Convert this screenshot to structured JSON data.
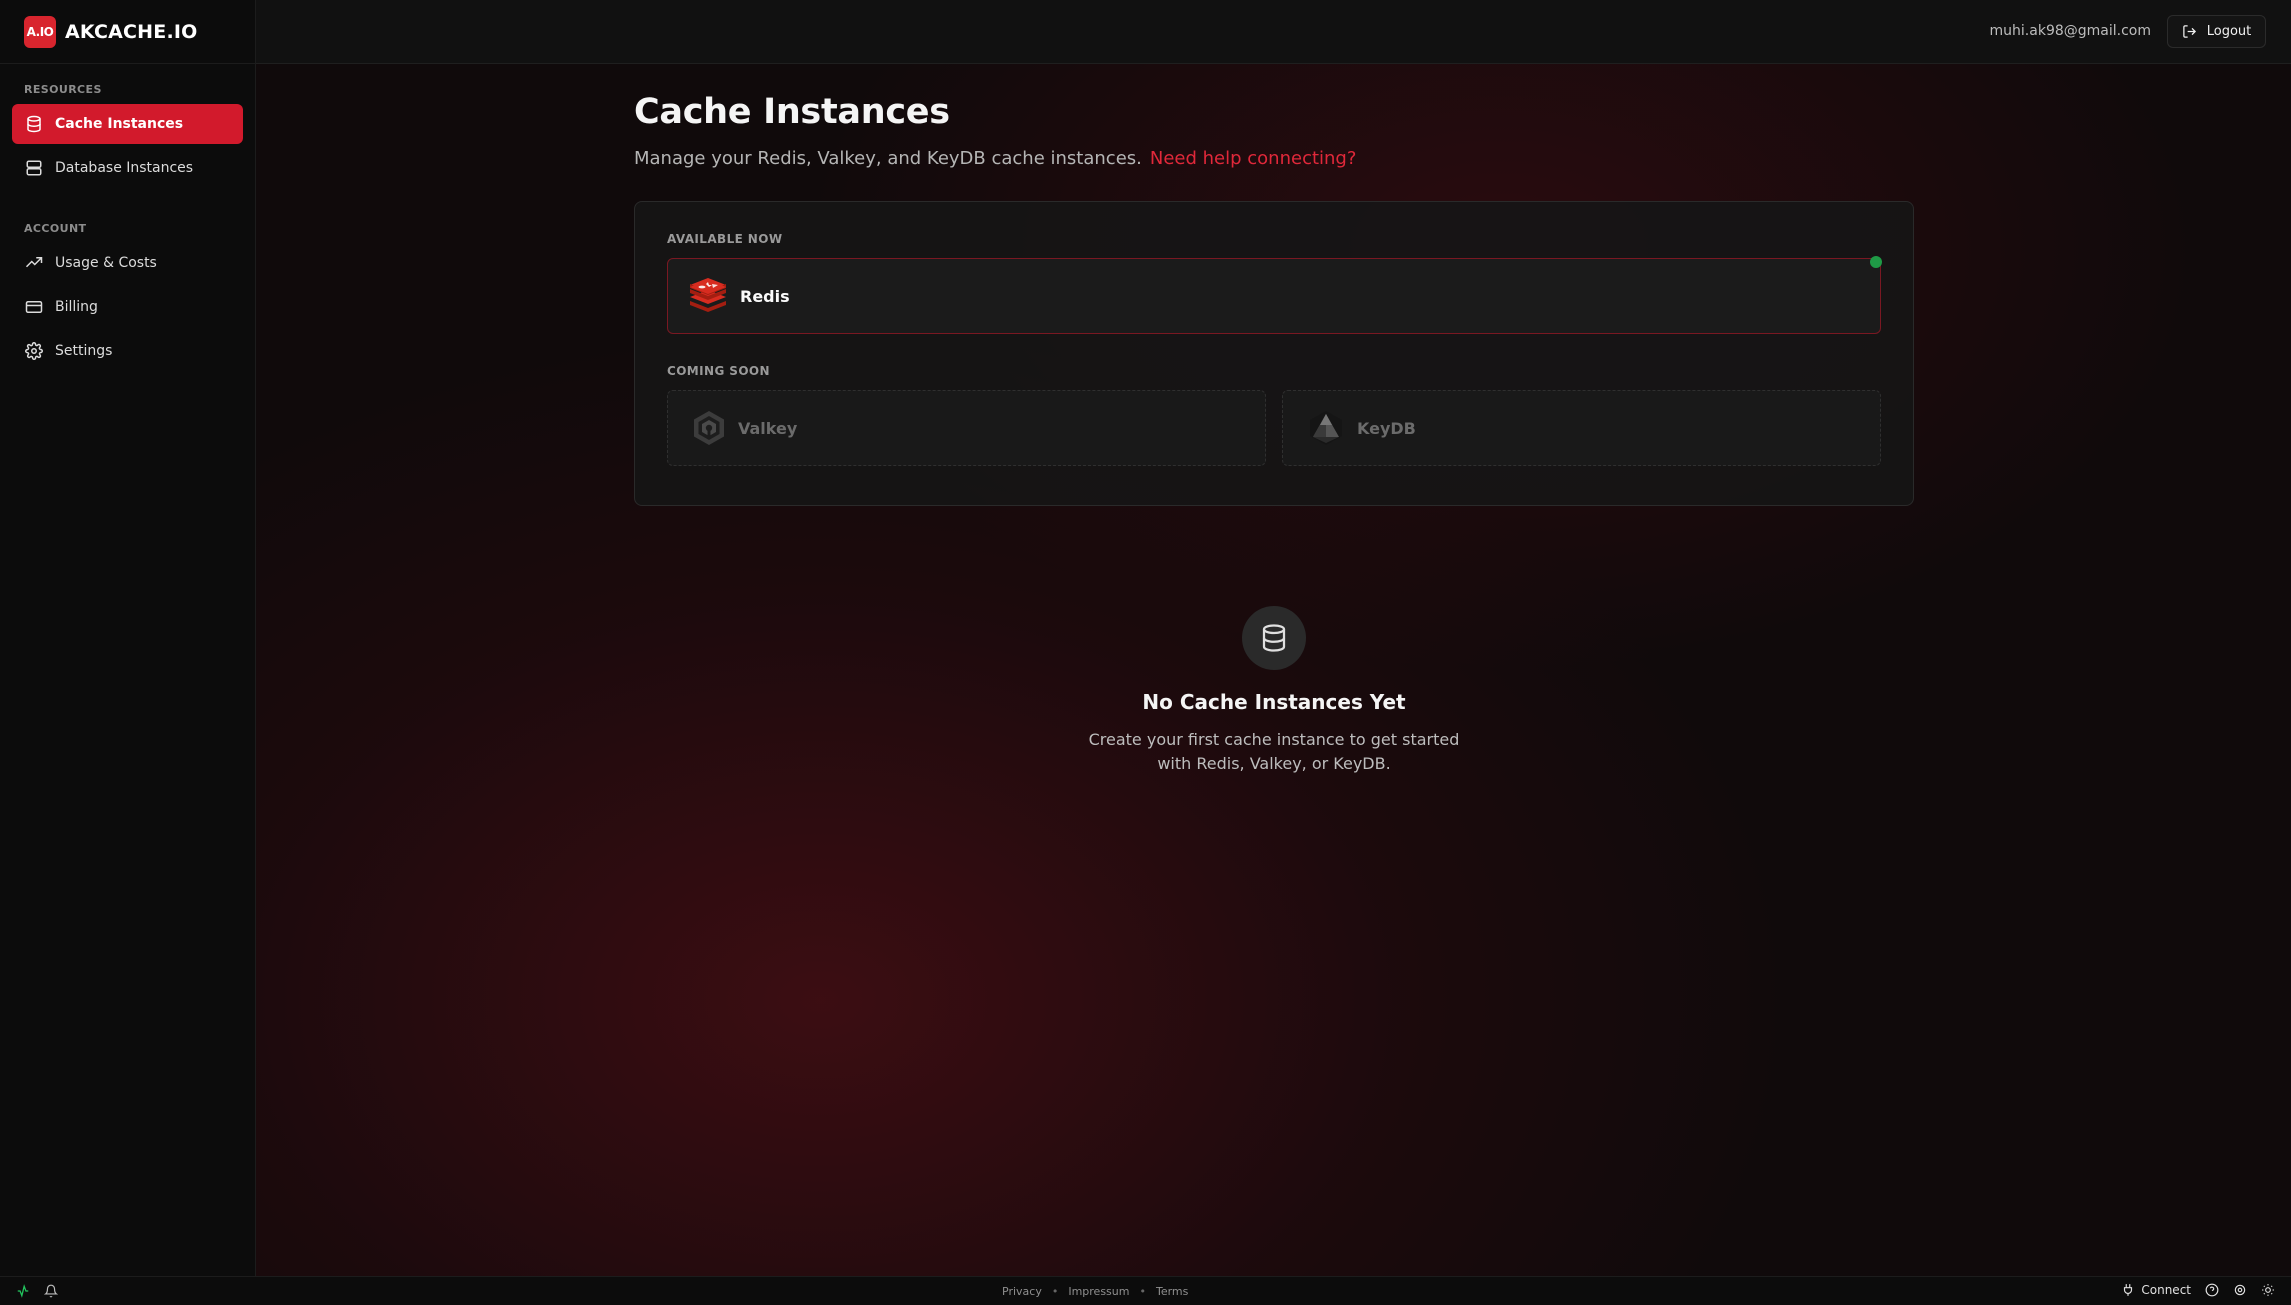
{
  "app": {
    "logo_badge": "A.IO",
    "name": "AKCACHE.IO",
    "accent_color": "#d21a2c"
  },
  "sidebar": {
    "sections": [
      {
        "label": "RESOURCES",
        "items": [
          {
            "label": "Cache Instances",
            "icon": "database-icon",
            "active": true
          },
          {
            "label": "Database Instances",
            "icon": "server-icon",
            "active": false
          }
        ]
      },
      {
        "label": "ACCOUNT",
        "items": [
          {
            "label": "Usage & Costs",
            "icon": "trending-up-icon",
            "active": false
          },
          {
            "label": "Billing",
            "icon": "credit-card-icon",
            "active": false
          },
          {
            "label": "Settings",
            "icon": "gear-icon",
            "active": false
          }
        ]
      }
    ]
  },
  "header": {
    "user_email": "muhi.ak98@gmail.com",
    "logout_label": "Logout"
  },
  "main": {
    "title": "Cache Instances",
    "subtitle": "Manage your Redis, Valkey, and KeyDB cache instances.",
    "help_link": "Need help connecting?",
    "available_label": "AVAILABLE NOW",
    "available_engines": [
      {
        "name": "Redis",
        "status_color": "#1f9a46"
      }
    ],
    "coming_soon_label": "COMING SOON",
    "coming_soon_engines": [
      {
        "name": "Valkey"
      },
      {
        "name": "KeyDB"
      }
    ],
    "empty_state": {
      "title": "No Cache Instances Yet",
      "text": "Create your first cache instance to get started with Redis, Valkey, or KeyDB."
    }
  },
  "footer": {
    "links": [
      "Privacy",
      "Impressum",
      "Terms"
    ],
    "separator": "•",
    "connect_label": "Connect"
  }
}
